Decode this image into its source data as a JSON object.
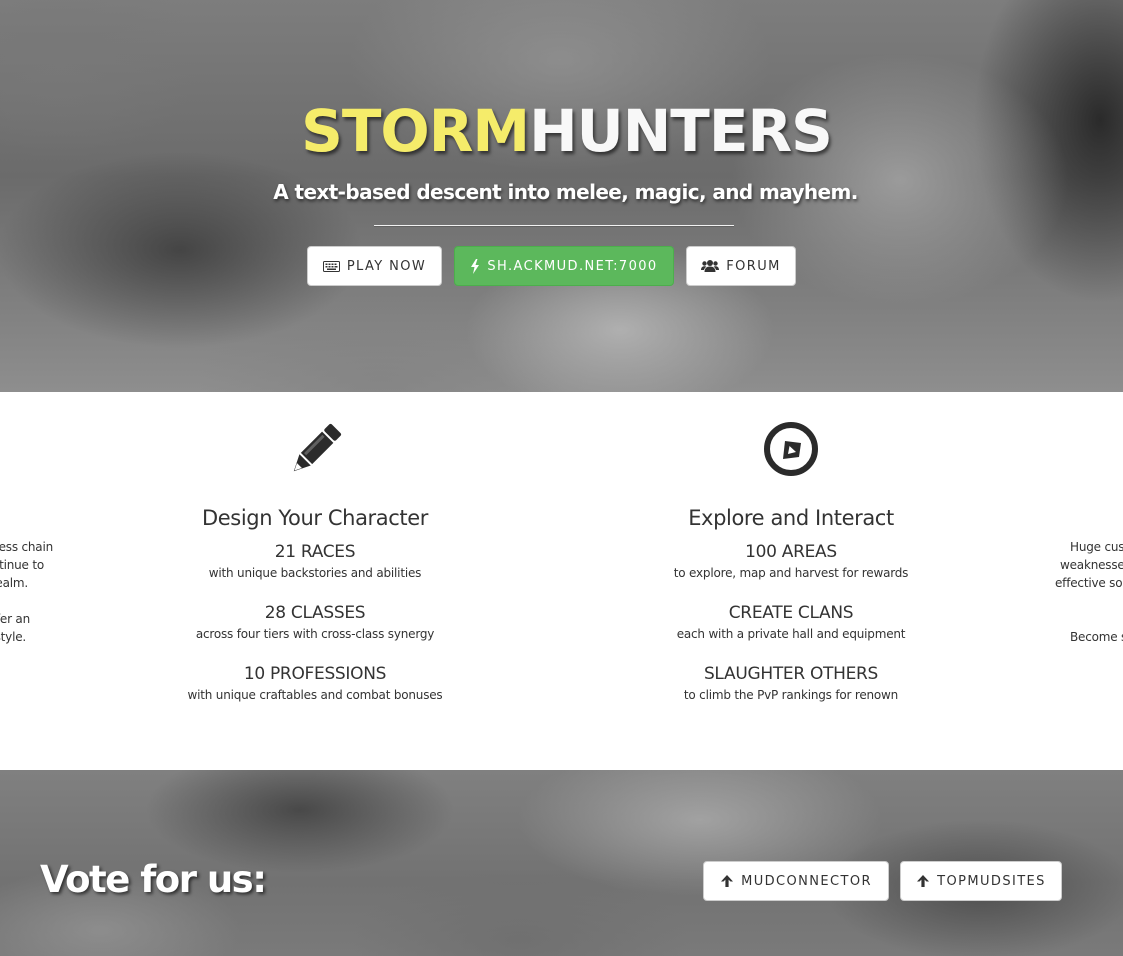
{
  "hero": {
    "title_part1": "STORM",
    "title_part2": "HUNTERS",
    "subtitle": "A text-based descent into melee, magic, and mayhem.",
    "buttons": [
      {
        "label": "PLAY NOW",
        "icon": "keyboard-icon"
      },
      {
        "label": "SH.ACKMUD.NET:7000",
        "icon": "bolt-icon"
      },
      {
        "label": "FORUM",
        "icon": "users-icon"
      }
    ],
    "title_color": "#f5ec6a",
    "accent_green": "#5cb85c"
  },
  "features": {
    "left_clipped": {
      "lines": [
        "less chain",
        "ntinue to",
        "ealm.",
        "",
        "fer an",
        "style."
      ]
    },
    "columns": [
      {
        "icon": "pencil-icon",
        "title": "Design Your Character",
        "items": [
          {
            "heading": "21 RACES",
            "text": "with unique backstories and abilities"
          },
          {
            "heading": "28 CLASSES",
            "text": "across four tiers with cross-class synergy"
          },
          {
            "heading": "10 PROFESSIONS",
            "text": "with unique craftables and combat bonuses"
          }
        ]
      },
      {
        "icon": "compass-icon",
        "title": "Explore and Interact",
        "items": [
          {
            "heading": "100 AREAS",
            "text": "to explore, map and harvest for rewards"
          },
          {
            "heading": "CREATE CLANS",
            "text": "each with a private hall and equipment"
          },
          {
            "heading": "SLAUGHTER OTHERS",
            "text": "to climb the PvP rankings for renown"
          }
        ]
      }
    ],
    "right_clipped": {
      "lines": [
        "Huge cust",
        "weaknesses",
        "effective sol",
        "",
        "",
        "Become s"
      ]
    }
  },
  "vote": {
    "title": "Vote for us:",
    "buttons": [
      {
        "label": "MUDCONNECTOR",
        "icon": "arrow-up-icon"
      },
      {
        "label": "TOPMUDSITES",
        "icon": "arrow-up-icon"
      }
    ]
  }
}
